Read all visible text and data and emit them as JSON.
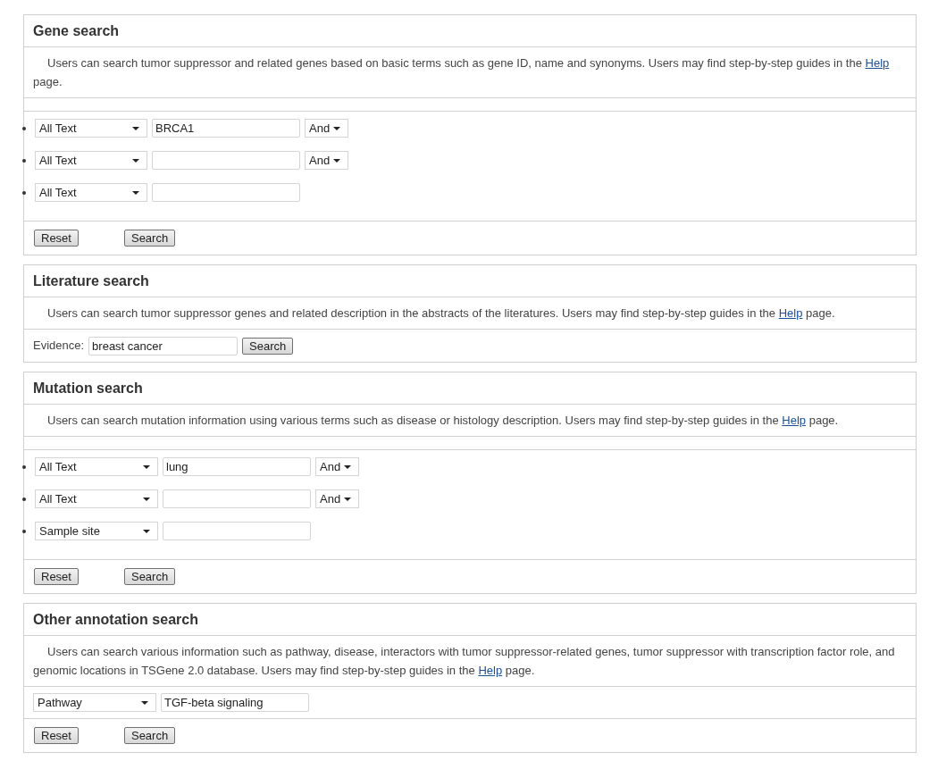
{
  "panels": [
    {
      "kind": "query_rows",
      "title": "Gene search",
      "description": {
        "before": "Users can search tumor suppressor and related genes based on basic terms such as gene ID, name and synonyms. Users may find step-by-step guides in the",
        "link": "Help",
        "after": "page."
      },
      "rows": [
        {
          "field": "All Text",
          "value": "BRCA1",
          "connector": "And"
        },
        {
          "field": "All Text",
          "value": "",
          "connector": "And"
        },
        {
          "field": "All Text",
          "value": ""
        }
      ],
      "buttons": [
        "Reset",
        "Search"
      ]
    },
    {
      "kind": "evidence",
      "title": "Literature search",
      "description": {
        "before": "Users can search tumor suppressor genes and related description in the abstracts of the literatures. Users may find step-by-step guides in the",
        "link": "Help",
        "after": "page."
      },
      "label": "Evidence:",
      "value": "breast cancer",
      "buttons": [
        "Search"
      ]
    },
    {
      "kind": "query_rows",
      "title": "Mutation search",
      "description": {
        "before": "Users can search mutation information using various terms such as disease or histology description. Users may find step-by-step guides in the",
        "link": "Help",
        "after": "page."
      },
      "rows": [
        {
          "field": "All Text",
          "value": "lung",
          "connector": "And"
        },
        {
          "field": "All Text",
          "value": "",
          "connector": "And"
        },
        {
          "field": "Sample site",
          "value": ""
        }
      ],
      "buttons": [
        "Reset",
        "Search"
      ]
    },
    {
      "kind": "single_row",
      "title": "Other annotation search",
      "description": {
        "before": "Users can search various information such as pathway, disease, interactors with tumor suppressor-related genes, tumor suppressor with transcription factor role, and genomic locations in TSGene 2.0 database. Users may find step-by-step guides in the",
        "link": "Help",
        "after": "page."
      },
      "rows": [
        {
          "field": "Pathway",
          "value": "TGF-beta signaling"
        }
      ],
      "buttons": [
        "Reset",
        "Search"
      ]
    }
  ]
}
